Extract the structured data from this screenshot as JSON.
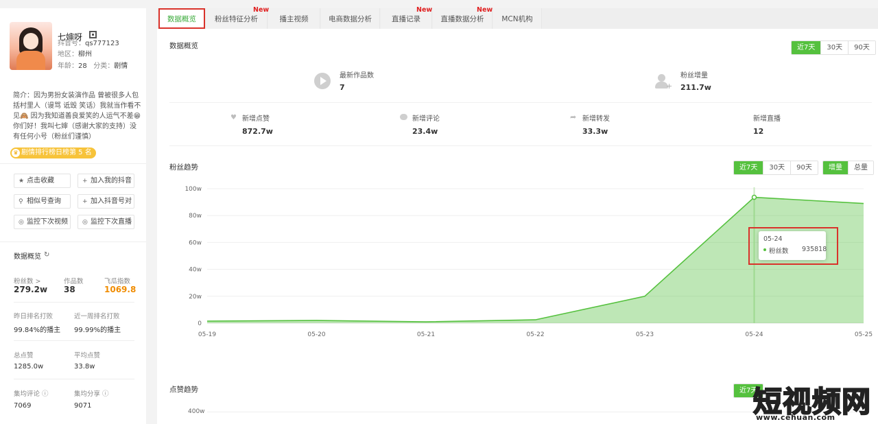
{
  "tabs": [
    {
      "label": "数据概览",
      "new": false
    },
    {
      "label": "粉丝特征分析",
      "new": true
    },
    {
      "label": "播主视频",
      "new": false
    },
    {
      "label": "电商数据分析",
      "new": false
    },
    {
      "label": "直播记录",
      "new": true
    },
    {
      "label": "直播数据分析",
      "new": true
    },
    {
      "label": "MCN机构",
      "new": false
    }
  ],
  "new_tag": "New",
  "profile": {
    "name": "七婶呀",
    "douyin_id_label": "抖音号：",
    "douyin_id": "qs777123",
    "region_label": "地区：",
    "region": "柳州",
    "age_label": "年龄：",
    "age": "28",
    "category_label": "分类：",
    "category": "剧情",
    "bio": "简介：因为男扮女装演作品 曾被很多人包括村里人（谩骂 诋毁 笑话）我就当作看不见🙈 因为我知道善良爱笑的人运气不差😁你们好！我叫七婶（感谢大家的支持）没有任何小号（粉丝们谨慎）",
    "rank_badge": "剧情排行榜日榜第 5 名"
  },
  "actions": [
    {
      "icon": "★",
      "label": "点击收藏"
    },
    {
      "icon": "+",
      "label": "加入我的抖音"
    },
    {
      "icon": "⚲",
      "label": "相似号查询"
    },
    {
      "icon": "+",
      "label": "加入抖音号对"
    },
    {
      "icon": "◎",
      "label": "监控下次视频"
    },
    {
      "icon": "◎",
      "label": "监控下次直播"
    }
  ],
  "sidebar_stats": {
    "title": "数据概览",
    "fans_label": "粉丝数 >",
    "fans": "279.2w",
    "works_label": "作品数",
    "works": "38",
    "index_label": "飞瓜指数",
    "index": "1069.8",
    "yday_rank_label": "昨日排名打败",
    "yday_rank": "99.84%的播主",
    "week_rank_label": "近一周排名打败",
    "week_rank": "99.99%的播主",
    "total_likes_label": "总点赞",
    "total_likes": "1285.0w",
    "avg_likes_label": "平均点赞",
    "avg_likes": "33.8w",
    "avg_comments_label": "集均评论 ⓘ",
    "avg_comments": "7069",
    "avg_shares_label": "集均分享 ⓘ",
    "avg_shares": "9071"
  },
  "overview": {
    "title": "数据概览",
    "ranges": [
      "近7天",
      "30天",
      "90天"
    ],
    "latest_works_label": "最新作品数",
    "latest_works": "7",
    "fans_growth_label": "粉丝增量",
    "fans_growth": "211.7w",
    "new_likes_label": "新增点赞",
    "new_likes": "872.7w",
    "new_comments_label": "新增评论",
    "new_comments": "23.4w",
    "new_shares_label": "新增转发",
    "new_shares": "33.3w",
    "new_lives_label": "新增直播",
    "new_lives": "12"
  },
  "fans_trend": {
    "title": "粉丝趋势",
    "ranges": [
      "近7天",
      "30天",
      "90天"
    ],
    "modes": [
      "增量",
      "总量"
    ]
  },
  "likes_trend": {
    "title": "点赞趋势",
    "range_first": "近7天",
    "ytick_top": "400w"
  },
  "tooltip": {
    "date": "05-24",
    "series": "粉丝数",
    "value": "935818"
  },
  "chart_data": {
    "type": "area",
    "x": [
      "05-19",
      "05-20",
      "05-21",
      "05-22",
      "05-23",
      "05-24",
      "05-25"
    ],
    "values": [
      1.5,
      2.0,
      1.0,
      2.5,
      20,
      93.6,
      89
    ],
    "ylim": [
      0,
      100
    ],
    "yticks": [
      0,
      20,
      40,
      60,
      80,
      100
    ],
    "ytick_labels": [
      "0",
      "20w",
      "40w",
      "60w",
      "80w",
      "100w"
    ],
    "unit": "w",
    "grid": true,
    "color": "#55c13e"
  },
  "watermark": {
    "cn": "短视频网",
    "url": "www.cehuan.com"
  }
}
